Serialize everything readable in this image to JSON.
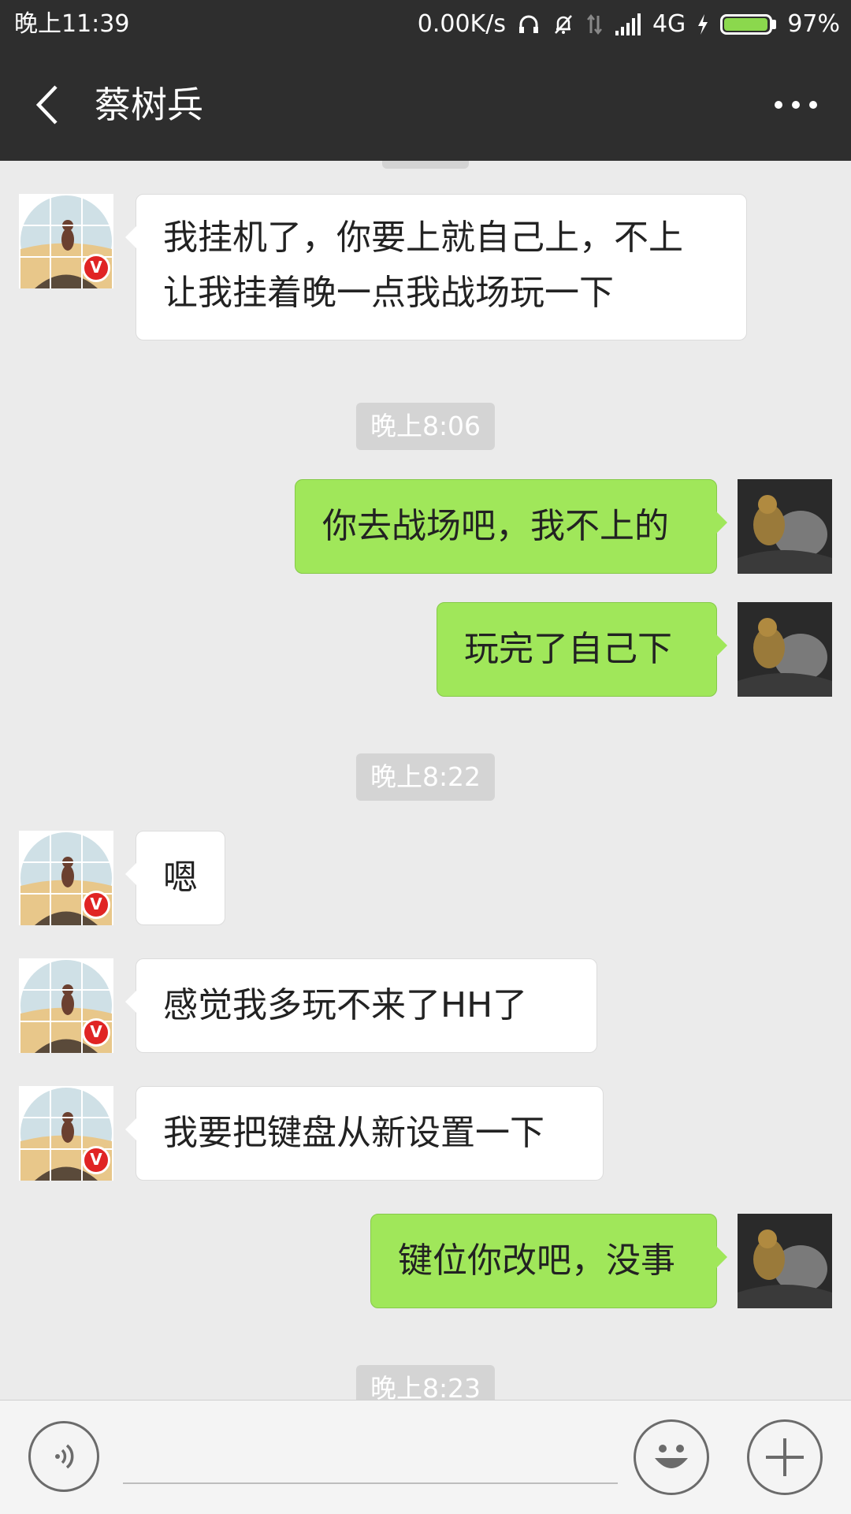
{
  "status_bar": {
    "time": "晚上11:39",
    "network_speed": "0.00K/s",
    "network_type": "4G",
    "battery_percent": "97%",
    "battery_level": 0.97
  },
  "header": {
    "back_icon": "chevron-left-icon",
    "title": "蔡树兵",
    "more_icon": "more-horizontal-icon"
  },
  "chat": {
    "timestamps": [
      "晚上8:06",
      "晚上8:22",
      "晚上8:23"
    ],
    "messages": [
      {
        "side": "left",
        "text_line1": "我挂机了，你要上就自己上，不上",
        "text_line2": "让我挂着晚一点我战场玩一下"
      },
      {
        "side": "right",
        "text": "你去战场吧，我不上的"
      },
      {
        "side": "right",
        "text": "玩完了自己下"
      },
      {
        "side": "left",
        "text": "嗯"
      },
      {
        "side": "left",
        "text": "感觉我多玩不来了HH了"
      },
      {
        "side": "left",
        "text": "我要把键盘从新设置一下"
      },
      {
        "side": "right",
        "text": "键位你改吧，没事"
      }
    ],
    "contact_badge": "V"
  },
  "input_bar": {
    "voice_icon": "voice-icon",
    "emoji_icon": "emoji-icon",
    "plus_icon": "plus-icon",
    "placeholder": ""
  },
  "colors": {
    "header_bg": "#2e2e2e",
    "chat_bg": "#ebebeb",
    "sent_bubble": "#a0e75a",
    "received_bubble": "#ffffff",
    "timestamp_bg": "#d4d4d4"
  }
}
